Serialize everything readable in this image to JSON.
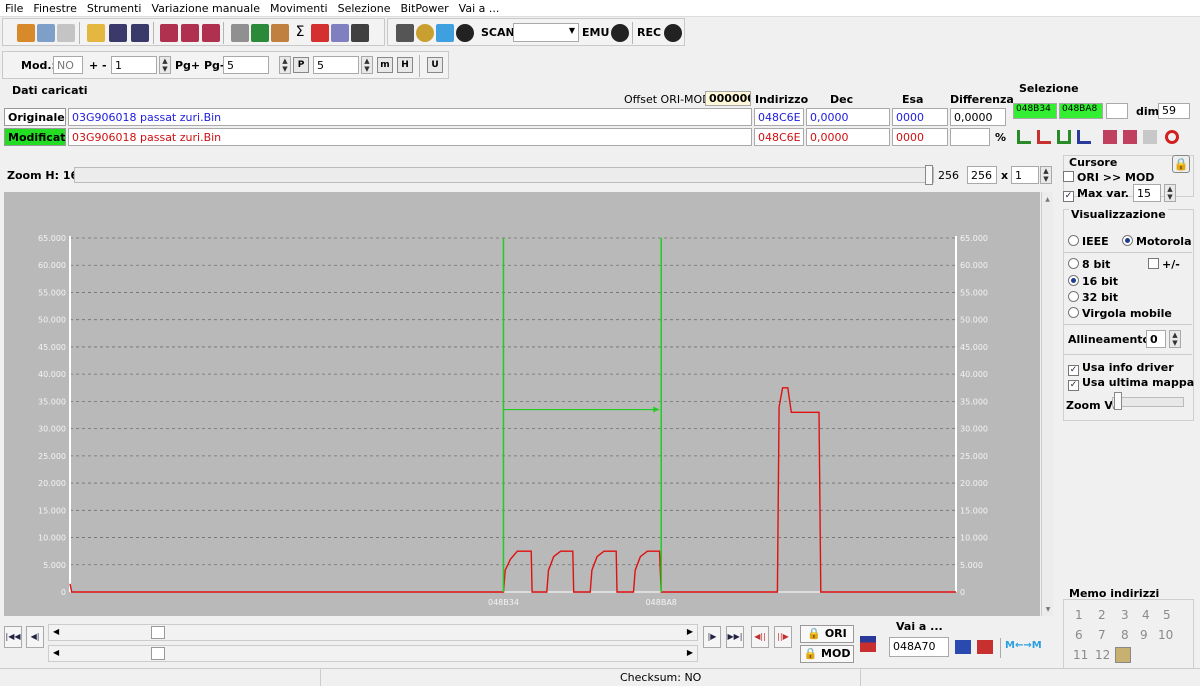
{
  "menu": [
    "File",
    "Finestre",
    "Strumenti",
    "Variazione manuale",
    "Movimenti",
    "Selezione",
    "BitPower",
    "Vai a ..."
  ],
  "toolbar": {
    "scan_label": "SCAN",
    "emu_label": "EMU",
    "rec_label": "REC",
    "mod_label": "Mod.:",
    "mod_value": "NO",
    "step_label": "+ -",
    "step_value": "1",
    "page_label": "Pg+ Pg-",
    "page_value": "5",
    "p_value": "5"
  },
  "loaded": {
    "title": "Dati caricati",
    "offset_label": "Offset ORI-MOD",
    "offset_value": "000000",
    "columns": {
      "address": "Indirizzo",
      "dec": "Dec",
      "hex": "Esa",
      "diff": "Differenza"
    },
    "original": {
      "label": "Originale",
      "file": "03G906018 passat zuri.Bin",
      "address": "048C6E",
      "dec": "0,0000",
      "hex": "0000",
      "diff": "0,0000"
    },
    "modified": {
      "label": "Modificato",
      "file": "03G906018 passat zuri.Bin",
      "address": "048C6E",
      "dec": "0,0000",
      "hex": "0000",
      "diff": "",
      "percent": "%"
    }
  },
  "selection": {
    "title": "Selezione",
    "start": "048B34",
    "end": "048BA8",
    "dim_label": "dim.",
    "dim_value": "59"
  },
  "zoom_h": {
    "label": "Zoom H: 16",
    "value_left": "256",
    "value_right": "256",
    "x_label": "x",
    "multiplier": "1"
  },
  "cursor_panel": {
    "title": "Cursore",
    "ori_mod": "ORI >> MOD",
    "ori_mod_checked": false,
    "max_var": "Max var.",
    "max_var_checked": true,
    "max_var_value": "15"
  },
  "display_panel": {
    "title": "Visualizzazione",
    "ieee": "IEEE",
    "motorola": "Motorola",
    "bit8": "8 bit",
    "plusminus": "+/-",
    "bit16": "16 bit",
    "bit32": "32 bit",
    "float": "Virgola mobile",
    "align_label": "Allineamento:",
    "align_value": "0",
    "use_driver": "Usa info driver",
    "use_last_map": "Usa ultima mappa",
    "zoom_v": "Zoom V:"
  },
  "memo": {
    "title": "Memo indirizzi",
    "slots": [
      "1",
      "2",
      "3",
      "4",
      "5",
      "6",
      "7",
      "8",
      "9",
      "10",
      "11",
      "12"
    ]
  },
  "bottom": {
    "ori_button": "ORI",
    "mod_button": "MOD",
    "goto_label": "Vai a ...",
    "goto_value": "048A70",
    "checksum": "Checksum: NO"
  },
  "colors": {
    "plot_bg": "#b9b9b9",
    "series_ori": "#1c1cff",
    "series_mod": "#e01010",
    "selection_marker": "#22cc22",
    "modified_label_bg": "#22dd22",
    "selection_bg": "#33ee33"
  },
  "chart_data": {
    "type": "line",
    "ylim": [
      0,
      65000
    ],
    "yticks": [
      "0",
      "5.000",
      "10.000",
      "15.000",
      "20.000",
      "25.000",
      "30.000",
      "35.000",
      "40.000",
      "45.000",
      "50.000",
      "55.000",
      "60.000",
      "65.000"
    ],
    "x_markers": [
      "048B34",
      "048BA8"
    ],
    "series": [
      {
        "values": [
          [
            0,
            1500
          ],
          [
            1,
            0
          ],
          [
            20,
            0
          ],
          [
            40,
            0
          ],
          [
            60,
            0
          ],
          [
            80,
            0
          ],
          [
            100,
            0
          ],
          [
            120,
            0
          ],
          [
            140,
            0
          ],
          [
            160,
            0
          ],
          [
            180,
            0
          ],
          [
            200,
            0
          ],
          [
            220,
            0
          ],
          [
            240,
            0
          ],
          [
            250,
            0
          ],
          [
            251,
            4000
          ],
          [
            254,
            6000
          ],
          [
            258,
            7500
          ],
          [
            266,
            7500
          ],
          [
            266.5,
            0
          ],
          [
            275,
            0
          ],
          [
            276,
            4000
          ],
          [
            279,
            6500
          ],
          [
            283,
            7500
          ],
          [
            290,
            7500
          ],
          [
            290.5,
            0
          ],
          [
            300,
            0
          ],
          [
            301,
            4000
          ],
          [
            304,
            6500
          ],
          [
            308,
            7500
          ],
          [
            315,
            7500
          ],
          [
            315.5,
            0
          ],
          [
            325,
            0
          ],
          [
            326,
            4000
          ],
          [
            329,
            6500
          ],
          [
            333,
            7500
          ],
          [
            340,
            7500
          ],
          [
            341,
            0
          ],
          [
            360,
            0
          ],
          [
            380,
            0
          ],
          [
            400,
            0
          ],
          [
            408,
            0
          ],
          [
            409,
            34000
          ],
          [
            411,
            37500
          ],
          [
            414,
            37500
          ],
          [
            416,
            33000
          ],
          [
            432,
            33000
          ],
          [
            433,
            0
          ],
          [
            460,
            0
          ],
          [
            480,
            0
          ],
          [
            500,
            0
          ],
          [
            511,
            0
          ]
        ]
      }
    ],
    "selection": {
      "start": 250,
      "end": 341,
      "arrow_y": 33500
    }
  }
}
